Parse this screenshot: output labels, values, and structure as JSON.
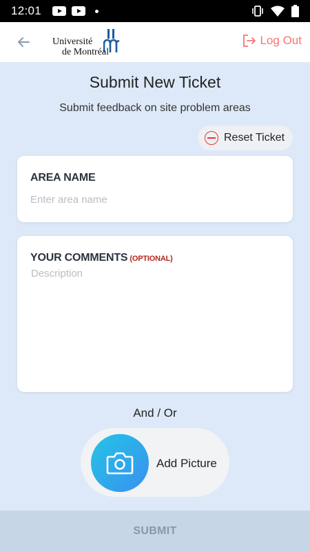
{
  "status_bar": {
    "time": "12:01"
  },
  "header": {
    "logo_line1": "Université",
    "logo_line2": "de Montréal",
    "logout_label": "Log Out"
  },
  "page": {
    "title": "Submit New Ticket",
    "subtitle": "Submit feedback on site problem areas",
    "reset_label": "Reset Ticket"
  },
  "area_card": {
    "label": "AREA NAME",
    "placeholder": "Enter area name",
    "value": ""
  },
  "comments_card": {
    "label": "YOUR COMMENTS",
    "optional_tag": "(OPTIONAL)",
    "placeholder": "Description",
    "value": ""
  },
  "and_or": "And / Or",
  "add_picture_label": "Add Picture",
  "submit_label": "SUBMIT",
  "colors": {
    "accent_red": "#f47474",
    "background": "#dde9f8",
    "camera_gradient_start": "#24c4e6",
    "camera_gradient_end": "#3a90f0",
    "submit_bg": "#c7d6e6"
  },
  "icons": [
    "youtube-icon",
    "dot-icon",
    "vibrate-icon",
    "wifi-icon",
    "battery-icon",
    "back-arrow-icon",
    "logout-icon",
    "reset-icon",
    "camera-icon"
  ]
}
